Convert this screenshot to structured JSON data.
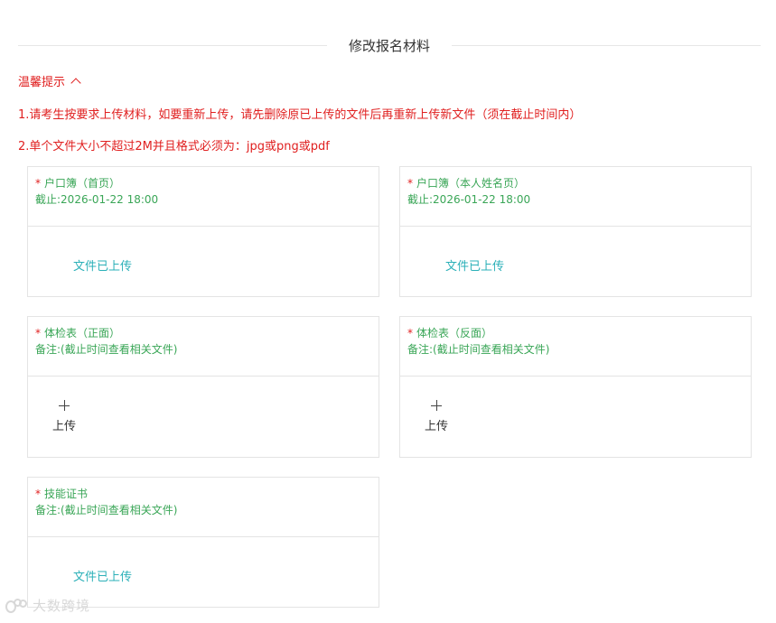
{
  "page": {
    "title": "修改报名材料"
  },
  "tips": {
    "header": "温馨提示",
    "lines": [
      "1.请考生按要求上传材料，如要重新上传，请先删除原已上传的文件后再重新上传新文件（须在截止时间内）",
      "2.单个文件大小不超过2M并且格式必须为：jpg或png或pdf"
    ]
  },
  "cards": [
    {
      "required_mark": "*",
      "name": "户口簿（首页）",
      "subtitle": "截止:2026-01-22 18:00",
      "status": "文件已上传"
    },
    {
      "required_mark": "*",
      "name": "户口簿（本人姓名页）",
      "subtitle": "截止:2026-01-22 18:00",
      "status": "文件已上传"
    },
    {
      "required_mark": "*",
      "name": "体检表（正面）",
      "subtitle": "备注:(截止时间查看相关文件)",
      "upload_label": "上传"
    },
    {
      "required_mark": "*",
      "name": "体检表（反面）",
      "subtitle": "备注:(截止时间查看相关文件)",
      "upload_label": "上传"
    },
    {
      "required_mark": "*",
      "name": "技能证书",
      "subtitle": "备注:(截止时间查看相关文件)",
      "status": "文件已上传"
    }
  ],
  "watermark": {
    "text": "大数跨境"
  },
  "colors": {
    "warning_red": "#e02020",
    "label_green": "#3aa657",
    "uploaded_teal": "#2bb0b8",
    "border": "#e4e4e4"
  }
}
